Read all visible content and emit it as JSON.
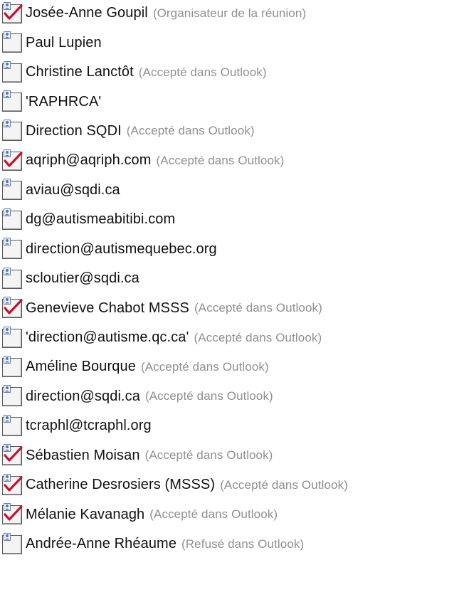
{
  "attendees": [
    {
      "name": "Josée-Anne Goupil",
      "status": "(Organisateur de la réunion)",
      "icon": "attendee-checked-icon"
    },
    {
      "name": "Paul Lupien",
      "status": "",
      "icon": "attendee-icon"
    },
    {
      "name": "Christine Lanctôt",
      "status": "(Accepté dans Outlook)",
      "icon": "attendee-icon"
    },
    {
      "name": "'RAPHRCA'",
      "status": "",
      "icon": "attendee-icon"
    },
    {
      "name": "Direction SQDI",
      "status": "(Accepté dans Outlook)",
      "icon": "attendee-icon"
    },
    {
      "name": "aqriph@aqriph.com",
      "status": "(Accepté dans Outlook)",
      "icon": "attendee-checked-icon"
    },
    {
      "name": "aviau@sqdi.ca",
      "status": "",
      "icon": "attendee-icon"
    },
    {
      "name": "dg@autismeabitibi.com",
      "status": "",
      "icon": "attendee-icon"
    },
    {
      "name": "direction@autismequebec.org",
      "status": "",
      "icon": "attendee-icon"
    },
    {
      "name": "scloutier@sqdi.ca",
      "status": "",
      "icon": "attendee-icon"
    },
    {
      "name": "Genevieve Chabot MSSS",
      "status": "(Accepté dans Outlook)",
      "icon": "attendee-checked-icon"
    },
    {
      "name": "'direction@autisme.qc.ca'",
      "status": "(Accepté dans Outlook)",
      "icon": "attendee-icon"
    },
    {
      "name": "Améline Bourque",
      "status": "(Accepté dans Outlook)",
      "icon": "attendee-icon"
    },
    {
      "name": "direction@sqdi.ca",
      "status": "(Accepté dans Outlook)",
      "icon": "attendee-icon"
    },
    {
      "name": "tcraphl@tcraphl.org",
      "status": "",
      "icon": "attendee-icon"
    },
    {
      "name": "Sébastien Moisan",
      "status": "(Accepté dans Outlook)",
      "icon": "attendee-checked-icon"
    },
    {
      "name": "Catherine Desrosiers (MSSS)",
      "status": "(Accepté dans Outlook)",
      "icon": "attendee-checked-icon"
    },
    {
      "name": "Mélanie Kavanagh",
      "status": "(Accepté dans Outlook)",
      "icon": "attendee-checked-icon"
    },
    {
      "name": "Andrée-Anne Rhéaume",
      "status": "(Refusé dans Outlook)",
      "icon": "attendee-icon"
    }
  ],
  "colors": {
    "name_text": "#111111",
    "status_text": "#8f8f8f",
    "check_mark": "#c8102e",
    "person_icon": "#4a78c2"
  }
}
